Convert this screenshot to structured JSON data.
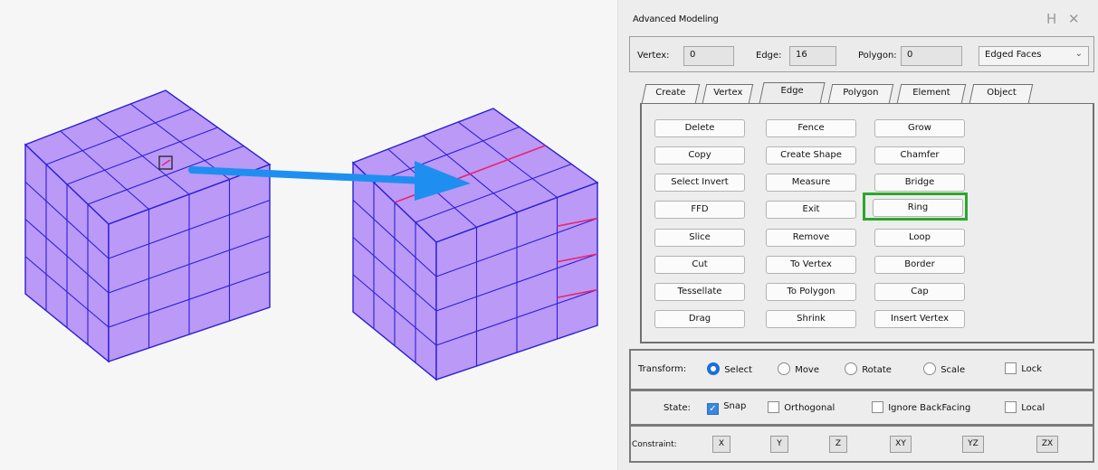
{
  "panel": {
    "title": "Advanced Modeling",
    "window_buttons": [
      "H",
      "✕"
    ],
    "vertex_label": "Vertex:",
    "vertex_value": "0",
    "edge_label": "Edge:",
    "edge_value": "16",
    "polygon_label": "Polygon:",
    "polygon_value": "0",
    "display_mode": "Edged Faces",
    "tabs": [
      "Create",
      "Vertex",
      "Edge",
      "Polygon",
      "Element",
      "Object"
    ],
    "active_tab": "Edge",
    "edge_buttons": {
      "col1": [
        "Delete",
        "Copy",
        "Select Invert",
        "FFD",
        "Slice",
        "Cut",
        "Tessellate",
        "Drag"
      ],
      "col2": [
        "Fence",
        "Create Shape",
        "Measure",
        "Exit",
        "Remove",
        "To Vertex",
        "To Polygon",
        "Shrink"
      ],
      "col3": [
        "Grow",
        "Chamfer",
        "Bridge",
        "Ring",
        "Loop",
        "Border",
        "Cap",
        "Insert Vertex"
      ]
    },
    "highlighted_button": "Ring",
    "transform": {
      "label": "Transform:",
      "options": [
        "Select",
        "Move",
        "Rotate",
        "Scale"
      ],
      "selected": "Select",
      "lock_label": "Lock",
      "lock_checked": false
    },
    "state": {
      "label": "State:",
      "snap_label": "Snap",
      "snap_checked": true,
      "orthogonal_label": "Orthogonal",
      "orthogonal_checked": false,
      "ignore_label": "Ignore BackFacing",
      "ignore_checked": false,
      "local_label": "Local",
      "local_checked": false
    },
    "constraint": {
      "label": "Constraint:",
      "axes": [
        "X",
        "Y",
        "Z",
        "XY",
        "YZ",
        "ZX"
      ]
    }
  },
  "colors": {
    "cube_face": "#bb99f7",
    "cube_edge": "#2a1fd8",
    "selected_edge": "#f0226a",
    "arrow": "#1e8ff0",
    "highlight": "#2ea62a"
  }
}
